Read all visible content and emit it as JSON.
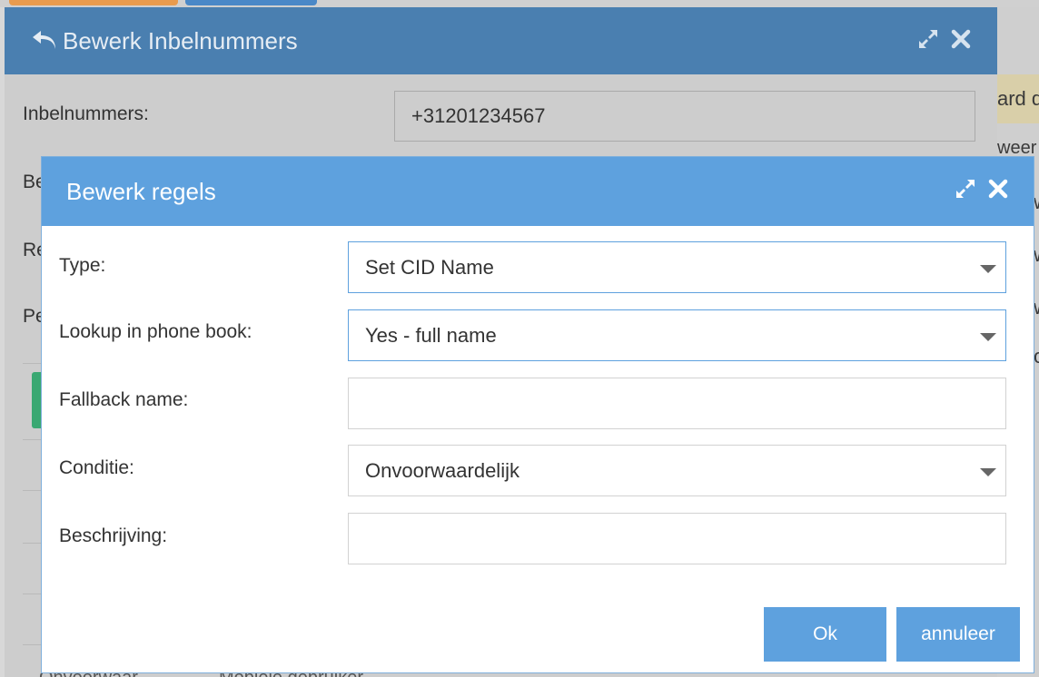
{
  "background": {
    "right_texts": [
      "ard d",
      "weer",
      "w",
      "w",
      "w",
      "o"
    ],
    "bottom_texts": [
      "Onvoorwaar",
      "Mobiele gebruiker"
    ]
  },
  "outer_dialog": {
    "title": "Bewerk Inbelnummers",
    "fields": [
      {
        "label": "Inbelnummers:",
        "value": "+31201234567"
      },
      {
        "label": "Be"
      },
      {
        "label": "Re"
      },
      {
        "label": "Pe"
      }
    ]
  },
  "inner_dialog": {
    "title": "Bewerk regels",
    "rows": [
      {
        "label": "Type:",
        "value": "Set CID Name",
        "kind": "select"
      },
      {
        "label": "Lookup in phone book:",
        "value": "Yes - full name",
        "kind": "select"
      },
      {
        "label": "Fallback name:",
        "value": "",
        "kind": "input"
      },
      {
        "label": "Conditie:",
        "value": "Onvoorwaardelijk",
        "kind": "select"
      },
      {
        "label": "Beschrijving:",
        "value": "",
        "kind": "input"
      }
    ],
    "buttons": {
      "ok": "Ok",
      "cancel": "annuleer"
    }
  },
  "colors": {
    "outer_header": "#4a7fb0",
    "inner_header": "#5ea1de",
    "button": "#5ea1de"
  },
  "icons": [
    "back-arrow-icon",
    "expand-icon",
    "close-icon",
    "chevron-down-icon"
  ]
}
